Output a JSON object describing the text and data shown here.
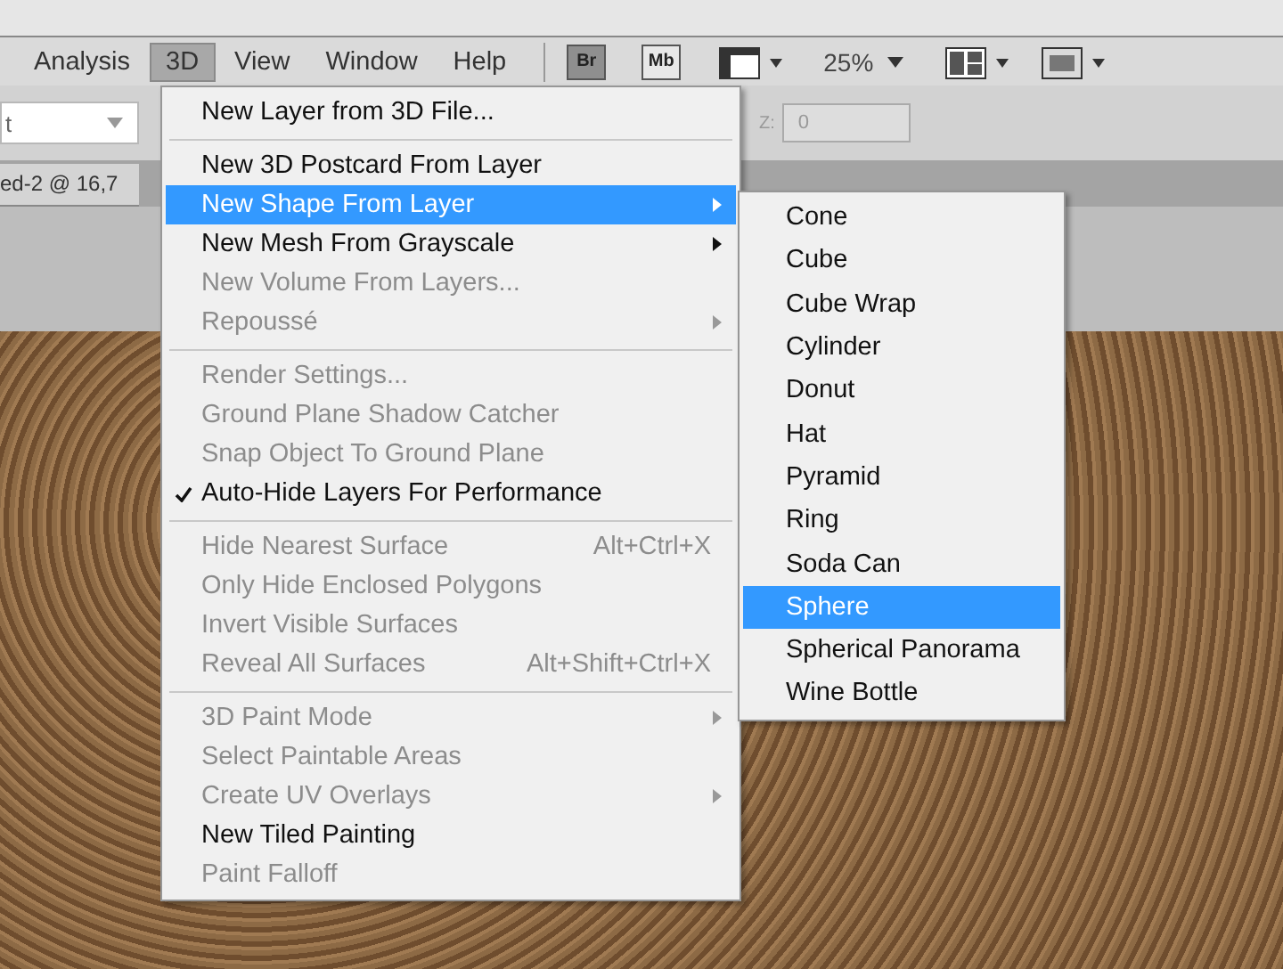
{
  "menubar": {
    "items": [
      {
        "label": "Analysis",
        "selected": false
      },
      {
        "label": "3D",
        "selected": true
      },
      {
        "label": "View",
        "selected": false
      },
      {
        "label": "Window",
        "selected": false
      },
      {
        "label": "Help",
        "selected": false
      }
    ]
  },
  "toolbar": {
    "bridge_button": "Br",
    "mini_bridge_button": "Mb",
    "zoom_level": "25%"
  },
  "options_bar": {
    "field_1": {
      "value": "t"
    },
    "z_field": {
      "label": "Z:",
      "value": "0"
    }
  },
  "document_tab": {
    "title": "ed-2 @ 16,7"
  },
  "menu": {
    "items": [
      {
        "kind": "item",
        "label": "New Layer from 3D File...",
        "disabled": false,
        "checked": false,
        "submenu": false,
        "selected": false
      },
      {
        "kind": "separator"
      },
      {
        "kind": "item",
        "label": "New 3D Postcard From Layer",
        "disabled": false,
        "checked": false,
        "submenu": false,
        "selected": false
      },
      {
        "kind": "item",
        "label": "New Shape From Layer",
        "disabled": false,
        "checked": false,
        "submenu": true,
        "selected": true
      },
      {
        "kind": "item",
        "label": "New Mesh From Grayscale",
        "disabled": false,
        "checked": false,
        "submenu": true,
        "selected": false
      },
      {
        "kind": "item",
        "label": "New Volume From Layers...",
        "disabled": true,
        "checked": false,
        "submenu": false,
        "selected": false
      },
      {
        "kind": "item",
        "label": "Repoussé",
        "disabled": true,
        "checked": false,
        "submenu": true,
        "selected": false
      },
      {
        "kind": "separator"
      },
      {
        "kind": "item",
        "label": "Render Settings...",
        "disabled": true,
        "checked": false,
        "submenu": false,
        "selected": false
      },
      {
        "kind": "item",
        "label": "Ground Plane Shadow Catcher",
        "disabled": true,
        "checked": false,
        "submenu": false,
        "selected": false
      },
      {
        "kind": "item",
        "label": "Snap Object To Ground Plane",
        "disabled": true,
        "checked": false,
        "submenu": false,
        "selected": false
      },
      {
        "kind": "item",
        "label": "Auto-Hide Layers For Performance",
        "disabled": false,
        "checked": true,
        "submenu": false,
        "selected": false
      },
      {
        "kind": "separator"
      },
      {
        "kind": "item",
        "label": "Hide Nearest Surface",
        "shortcut": "Alt+Ctrl+X",
        "disabled": true,
        "checked": false,
        "submenu": false,
        "selected": false
      },
      {
        "kind": "item",
        "label": "Only Hide Enclosed Polygons",
        "disabled": true,
        "checked": false,
        "submenu": false,
        "selected": false
      },
      {
        "kind": "item",
        "label": "Invert Visible Surfaces",
        "disabled": true,
        "checked": false,
        "submenu": false,
        "selected": false
      },
      {
        "kind": "item",
        "label": "Reveal All Surfaces",
        "shortcut": "Alt+Shift+Ctrl+X",
        "disabled": true,
        "checked": false,
        "submenu": false,
        "selected": false
      },
      {
        "kind": "separator"
      },
      {
        "kind": "item",
        "label": "3D Paint Mode",
        "disabled": true,
        "checked": false,
        "submenu": true,
        "selected": false
      },
      {
        "kind": "item",
        "label": "Select Paintable Areas",
        "disabled": true,
        "checked": false,
        "submenu": false,
        "selected": false
      },
      {
        "kind": "item",
        "label": "Create UV Overlays",
        "disabled": true,
        "checked": false,
        "submenu": true,
        "selected": false
      },
      {
        "kind": "item",
        "label": "New Tiled Painting",
        "disabled": false,
        "checked": false,
        "submenu": false,
        "selected": false
      },
      {
        "kind": "item",
        "label": "Paint Falloff",
        "disabled": true,
        "checked": false,
        "submenu": false,
        "selected": false
      }
    ]
  },
  "submenu": {
    "items": [
      {
        "label": "Cone",
        "selected": false
      },
      {
        "label": "Cube",
        "selected": false
      },
      {
        "label": "Cube Wrap",
        "selected": false
      },
      {
        "label": "Cylinder",
        "selected": false
      },
      {
        "label": "Donut",
        "selected": false
      },
      {
        "label": "Hat",
        "selected": false
      },
      {
        "label": "Pyramid",
        "selected": false
      },
      {
        "label": "Ring",
        "selected": false
      },
      {
        "label": "Soda Can",
        "selected": false
      },
      {
        "label": "Sphere",
        "selected": true
      },
      {
        "label": "Spherical Panorama",
        "selected": false
      },
      {
        "label": "Wine Bottle",
        "selected": false
      }
    ]
  }
}
